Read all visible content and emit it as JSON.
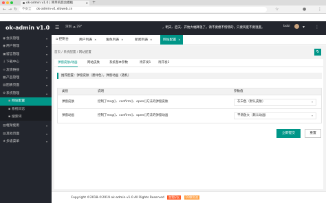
{
  "browser": {
    "tab_title": "ok-admin v1.0 | 简单的后台模板",
    "security_label": "不安全",
    "url": "ok-admin-v1.xlbweb.cn"
  },
  "header": {
    "brand": "ok-admin v1.0",
    "weather_city": "深圳",
    "weather_temp": "29°",
    "marquee": "，明天、后天、开始大幅降温了。请不要傻不愣愣的，只要风度不要温度。",
    "username": "bobi"
  },
  "sidebar": {
    "items": [
      {
        "label": "会员管理",
        "icon": "user-icon"
      },
      {
        "label": "用户管理",
        "icon": "users-icon"
      },
      {
        "label": "留言管理",
        "icon": "message-icon"
      },
      {
        "label": "下载中心",
        "icon": "download-icon"
      },
      {
        "label": "友情链接",
        "icon": "link-icon"
      },
      {
        "label": "产品管理",
        "icon": "box-icon"
      },
      {
        "label": "图表页面",
        "icon": "chart-icon"
      },
      {
        "label": "系统管理",
        "icon": "gear-icon"
      }
    ],
    "sub_items": [
      {
        "label": "网站配置"
      },
      {
        "label": "系统日志"
      },
      {
        "label": "搜索词"
      }
    ],
    "bottom_items": [
      {
        "label": "框架使用"
      },
      {
        "label": "其他页面"
      },
      {
        "label": "多级菜单"
      }
    ]
  },
  "tabs": [
    {
      "label": "控制台"
    },
    {
      "label": "用户列表"
    },
    {
      "label": "角色列表"
    },
    {
      "label": "新闻列表"
    },
    {
      "label": "网站配置"
    }
  ],
  "breadcrumb": "首页 / 系统配置 / 网站配置",
  "subtabs": [
    {
      "label": "弹窗皮肤/动画"
    },
    {
      "label": "网站皮肤"
    },
    {
      "label": "系统基本参数"
    },
    {
      "label": "待开发1"
    },
    {
      "label": "待开发2"
    }
  ],
  "note": "推荐配置：弹窗皮肤（墨绿色），弹窗动画（随机）",
  "table": {
    "headers": {
      "category": "类别",
      "desc": "说明",
      "value": "参数值"
    },
    "rows": [
      {
        "category": "弹窗皮肤",
        "desc": "控制了msg()、confirm()、open()方法的弹窗皮肤",
        "value": "灰白色（默认皮肤）"
      },
      {
        "category": "弹窗动画",
        "desc": "控制了msg()、confirm()、open()方法的弹窗动画",
        "value": "平滑放大（默认动画）"
      }
    ]
  },
  "buttons": {
    "submit": "立即提交",
    "reset": "重置"
  },
  "footer": {
    "copyright": "Copyright ©2018-©2019 ok-admin v1.0 All Rights Reserved",
    "badge1": "加我好友",
    "badge2": "QQ群交流"
  },
  "colors": {
    "accent": "#009688",
    "sidebar_bg": "#23262e",
    "badge_red": "#ff5722",
    "badge_orange": "#ff9f43"
  }
}
